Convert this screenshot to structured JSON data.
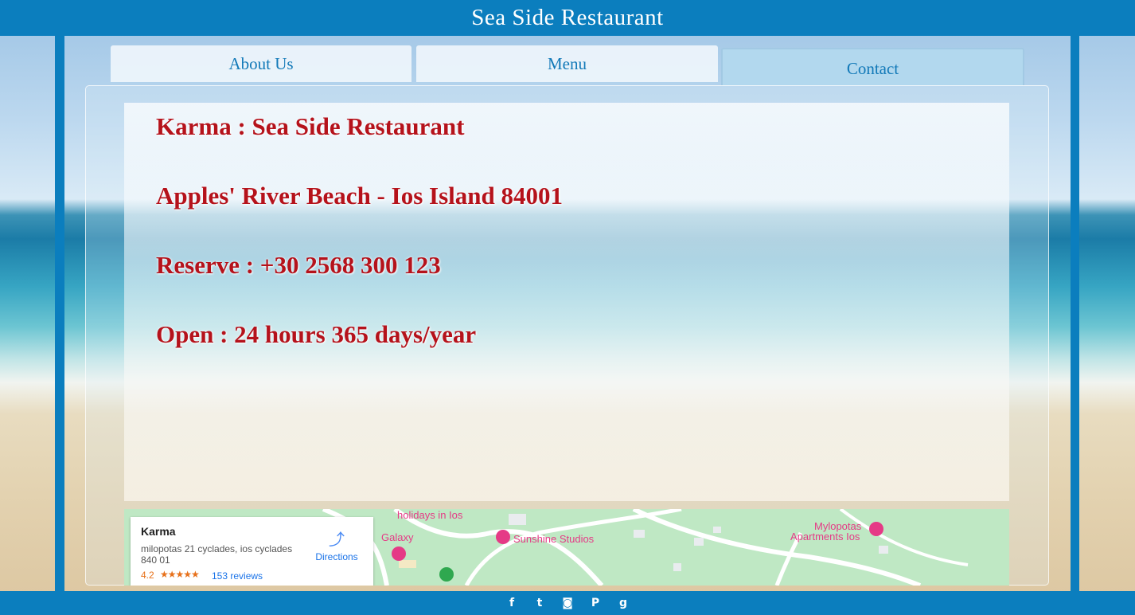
{
  "header": {
    "title": "Sea Side Restaurant"
  },
  "tabs": [
    {
      "label": "About Us",
      "active": false
    },
    {
      "label": "Menu",
      "active": false
    },
    {
      "label": "Contact",
      "active": true
    }
  ],
  "contact": {
    "name": "Karma : Sea Side Restaurant",
    "address": "Apples' River Beach - Ios Island 84001",
    "reserve": "Reserve : +30 2568 300 123",
    "hours": "Open : 24 hours 365 days/year"
  },
  "map": {
    "card": {
      "name": "Karma",
      "address": "milopotas 21 cyclades, ios cyclades 840 01",
      "rating": "4.2",
      "stars": "★★★★★",
      "reviews": "153 reviews",
      "directions": "Directions"
    },
    "labels": {
      "holidays": "holidays in Ios",
      "galaxy": "Galaxy",
      "sunshine": "Sunshine Studios",
      "mylopotas_1": "Mylopotas",
      "mylopotas_2": "Apartments Ios"
    }
  },
  "footer": {
    "social": [
      {
        "icon": "facebook-icon",
        "glyph": "f"
      },
      {
        "icon": "twitter-icon",
        "glyph": "t"
      },
      {
        "icon": "instagram-icon",
        "glyph": "◙"
      },
      {
        "icon": "pinterest-icon",
        "glyph": "P"
      },
      {
        "icon": "google-plus-icon",
        "glyph": "g"
      }
    ]
  },
  "colors": {
    "brand_blue": "#0b7ebe",
    "text_red": "#b5121b",
    "tab_text": "#1279b8"
  }
}
